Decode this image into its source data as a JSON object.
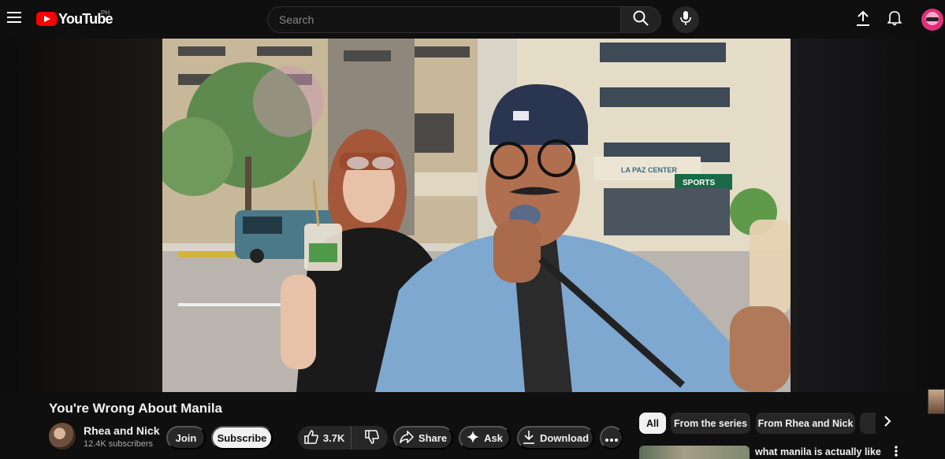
{
  "header": {
    "logo_text": "YouTube",
    "country_code": "PH",
    "search_placeholder": "Search",
    "icons": [
      "menu-icon",
      "search-icon",
      "mic-icon",
      "upload-icon",
      "bell-icon"
    ]
  },
  "video": {
    "scene_sign_1": "LA PAZ CENTER",
    "scene_sign_2": "SPORTS"
  },
  "details": {
    "title": "You're Wrong About Manila",
    "channel_name": "Rhea and Nick",
    "subscribers": "12.4K subscribers",
    "join_label": "Join",
    "subscribe_label": "Subscribe",
    "like_count": "3.7K",
    "share_label": "Share",
    "ask_label": "Ask",
    "download_label": "Download"
  },
  "sidebar": {
    "chips": [
      "All",
      "From the series",
      "From Rhea and Nick"
    ],
    "active_chip": "All",
    "recommendation_title": "what manila is actually like"
  },
  "colors": {
    "background": "#0f0f0f",
    "brand_red": "#ff0000",
    "pill_bg": "#272727",
    "subscribe_bg": "#f1f1f1"
  }
}
